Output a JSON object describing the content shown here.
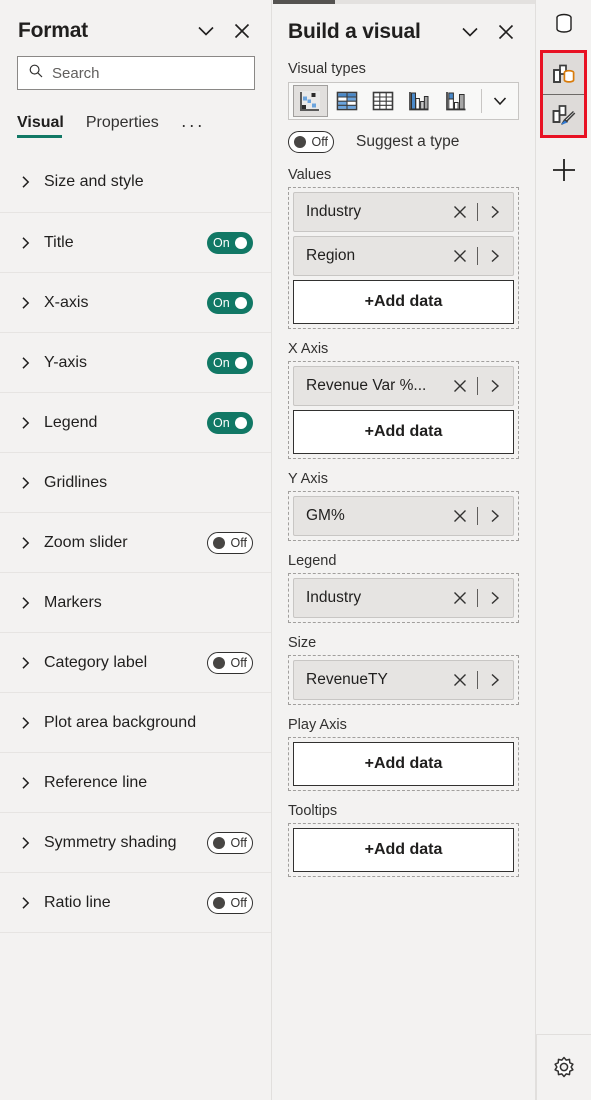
{
  "format_pane": {
    "title": "Format",
    "collapse_icon": "chevron-down-icon",
    "close_icon": "close-icon",
    "search": {
      "placeholder": "Search",
      "value": "",
      "icon": "search-icon"
    },
    "tabs": [
      {
        "label": "Visual",
        "active": true
      },
      {
        "label": "Properties",
        "active": false
      }
    ],
    "more_tabs": "···",
    "accent_color": "#117865",
    "sections": [
      {
        "label": "Size and style",
        "toggle": null
      },
      {
        "label": "Title",
        "toggle": "On"
      },
      {
        "label": "X-axis",
        "toggle": "On"
      },
      {
        "label": "Y-axis",
        "toggle": "On"
      },
      {
        "label": "Legend",
        "toggle": "On"
      },
      {
        "label": "Gridlines",
        "toggle": null
      },
      {
        "label": "Zoom slider",
        "toggle": "Off"
      },
      {
        "label": "Markers",
        "toggle": null
      },
      {
        "label": "Category label",
        "toggle": "Off"
      },
      {
        "label": "Plot area background",
        "toggle": null
      },
      {
        "label": "Reference line",
        "toggle": null
      },
      {
        "label": "Symmetry shading",
        "toggle": "Off"
      },
      {
        "label": "Ratio line",
        "toggle": "Off"
      }
    ]
  },
  "build_pane": {
    "title": "Build a visual",
    "collapse_icon": "chevron-down-icon",
    "close_icon": "close-icon",
    "visual_types_label": "Visual types",
    "visual_types": [
      {
        "name": "scatter-chart-icon",
        "selected": true
      },
      {
        "name": "matrix-table-icon",
        "selected": false
      },
      {
        "name": "table-icon",
        "selected": false
      },
      {
        "name": "clustered-column-chart-icon",
        "selected": false
      },
      {
        "name": "stacked-column-chart-icon",
        "selected": false
      }
    ],
    "visual_types_more_icon": "chevron-down-icon",
    "suggest": {
      "toggle": "Off",
      "label": "Suggest a type"
    },
    "wells": [
      {
        "label": "Values",
        "fields": [
          "Industry",
          "Region"
        ],
        "add_label": "+Add data"
      },
      {
        "label": "X Axis",
        "fields": [
          "Revenue Var %..."
        ],
        "add_label": "+Add data"
      },
      {
        "label": "Y Axis",
        "fields": [
          "GM%"
        ],
        "add_label": null
      },
      {
        "label": "Legend",
        "fields": [
          "Industry"
        ],
        "add_label": null
      },
      {
        "label": "Size",
        "fields": [
          "RevenueTY"
        ],
        "add_label": null
      },
      {
        "label": "Play Axis",
        "fields": [],
        "add_label": "+Add data"
      },
      {
        "label": "Tooltips",
        "fields": [],
        "add_label": "+Add data"
      }
    ],
    "pill_remove_icon": "close-icon",
    "pill_expand_icon": "chevron-right-icon"
  },
  "rail": {
    "highlight_color": "#e81123",
    "items": [
      {
        "name": "data-cylinder-icon",
        "highlighted": false
      },
      {
        "name": "build-visual-icon",
        "highlighted": true
      },
      {
        "name": "format-visual-brush-icon",
        "highlighted": true
      },
      {
        "name": "add-plus-icon",
        "highlighted": false
      }
    ],
    "settings_icon": "gear-icon"
  }
}
